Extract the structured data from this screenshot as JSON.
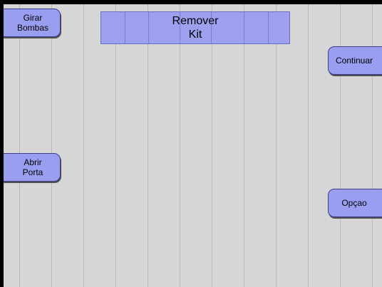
{
  "buttons": {
    "girar_bombas": {
      "line1": "Girar",
      "line2": "Bombas"
    },
    "remover_kit": {
      "line1": "Remover",
      "line2": "Kit"
    },
    "continuar": {
      "label": "Continuar"
    },
    "abrir_porta": {
      "line1": "Abrir",
      "line2": "Porta"
    },
    "opcao": {
      "label": "Opçao"
    }
  },
  "colors": {
    "background": "#d6d6d6",
    "button": "#9a9ef0",
    "frame": "#000000"
  }
}
